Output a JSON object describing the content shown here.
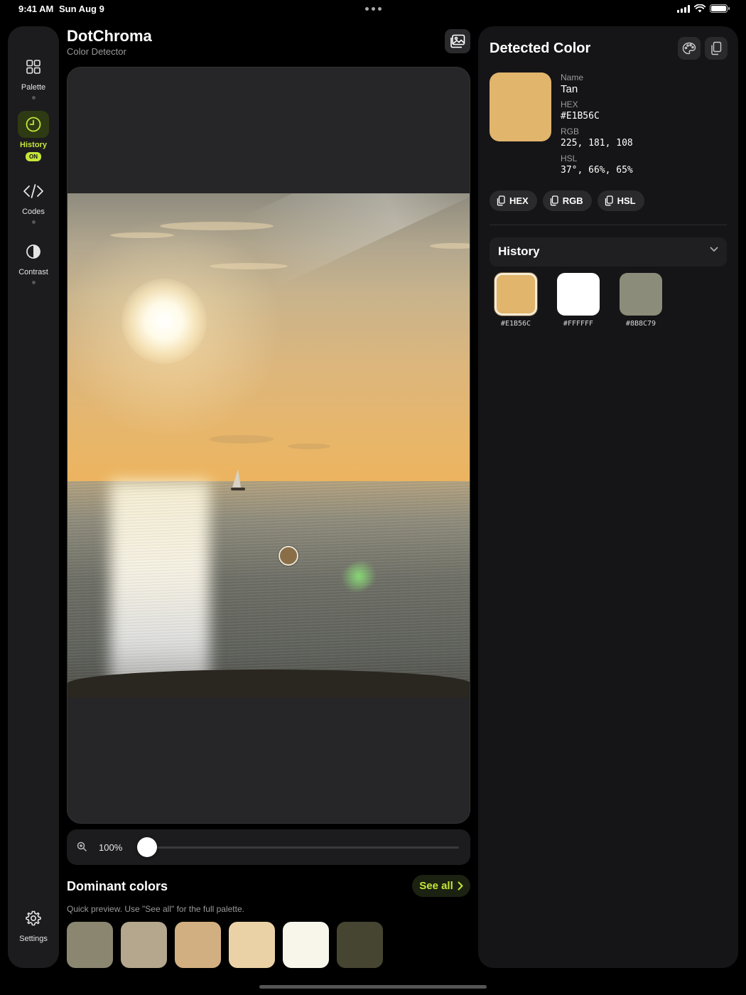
{
  "status": {
    "time": "9:41 AM",
    "date": "Sun Aug 9"
  },
  "sidebar": {
    "items": [
      {
        "label": "Palette",
        "icon": "grid-icon"
      },
      {
        "label": "History",
        "icon": "clock-icon",
        "badge": "ON",
        "active": true
      },
      {
        "label": "Codes",
        "icon": "code-icon"
      },
      {
        "label": "Contrast",
        "icon": "contrast-icon"
      }
    ],
    "settings_label": "Settings"
  },
  "header": {
    "title": "DotChroma",
    "subtitle": "Color Detector"
  },
  "zoom": {
    "label": "100%",
    "value": 0.02
  },
  "dominant": {
    "title": "Dominant colors",
    "see_all": "See all",
    "subtitle": "Quick preview. Use \"See all\" for the full palette.",
    "colors": [
      "#8B8670",
      "#B5A68E",
      "#D2AF80",
      "#EBD2A6",
      "#F8F6EB",
      "#464531"
    ]
  },
  "detected": {
    "title": "Detected Color",
    "color": "#E1B56C",
    "name_label": "Name",
    "name": "Tan",
    "hex_label": "HEX",
    "hex": "#E1B56C",
    "rgb_label": "RGB",
    "rgb": "225, 181, 108",
    "hsl_label": "HSL",
    "hsl": "37°, 66%, 65%",
    "copy_buttons": [
      "HEX",
      "RGB",
      "HSL"
    ]
  },
  "history": {
    "title": "History",
    "items": [
      {
        "hex": "#E1B56C",
        "selected": true
      },
      {
        "hex": "#FFFFFF",
        "selected": false
      },
      {
        "hex": "#8B8C79",
        "selected": false
      }
    ]
  },
  "accent": "#C5E63A"
}
